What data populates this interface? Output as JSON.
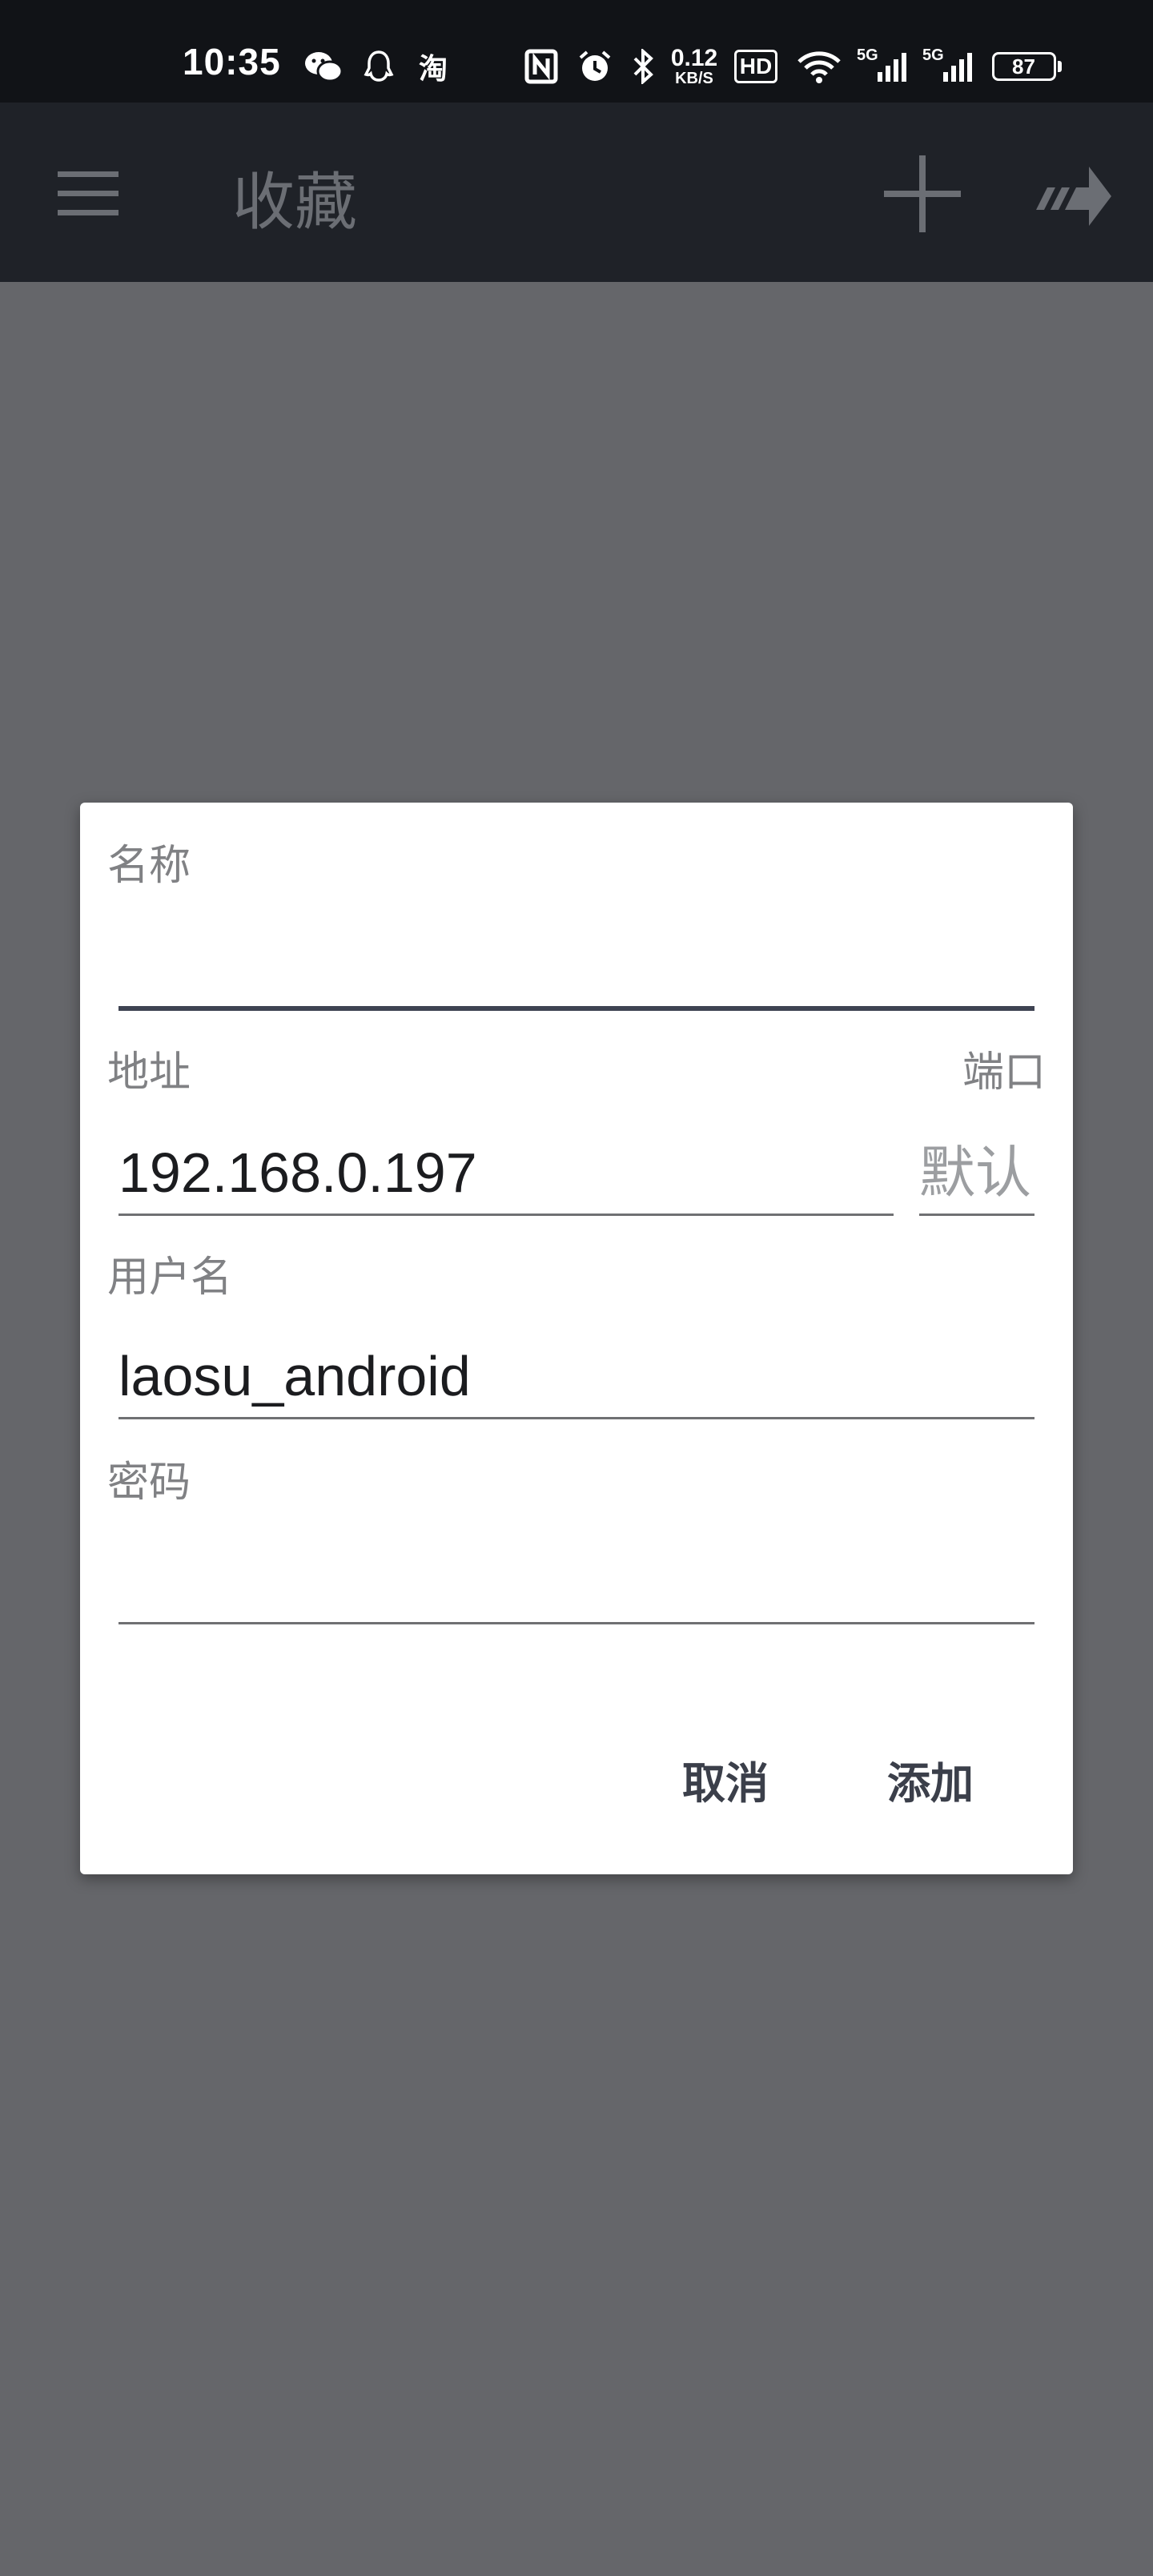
{
  "status_bar": {
    "time": "10:35",
    "network_speed_value": "0.12",
    "network_speed_unit": "KB/S",
    "hd_badge": "HD",
    "signal1_label": "5G",
    "signal2_label": "5G",
    "battery": "87",
    "icons": [
      "wechat-icon",
      "qq-icon",
      "taobao-icon",
      "nfc-icon",
      "alarm-icon",
      "bluetooth-icon",
      "wifi-icon",
      "signal-icon",
      "battery-icon"
    ]
  },
  "app_bar": {
    "title": "收藏",
    "icons": [
      "menu-icon",
      "add-icon",
      "forward-icon"
    ]
  },
  "dialog": {
    "name_label": "名称",
    "name_value": "",
    "address_label": "地址",
    "address_value": "192.168.0.197",
    "port_label": "端口",
    "port_placeholder": "默认",
    "username_label": "用户名",
    "username_value": "laosu_android",
    "password_label": "密码",
    "password_value": "",
    "cancel_label": "取消",
    "add_label": "添加"
  },
  "colors": {
    "scrim": "#65666a",
    "status_bar": "#111317",
    "app_bar": "#1f2228",
    "dialog_bg": "#ffffff",
    "accent": "#3e4352"
  }
}
